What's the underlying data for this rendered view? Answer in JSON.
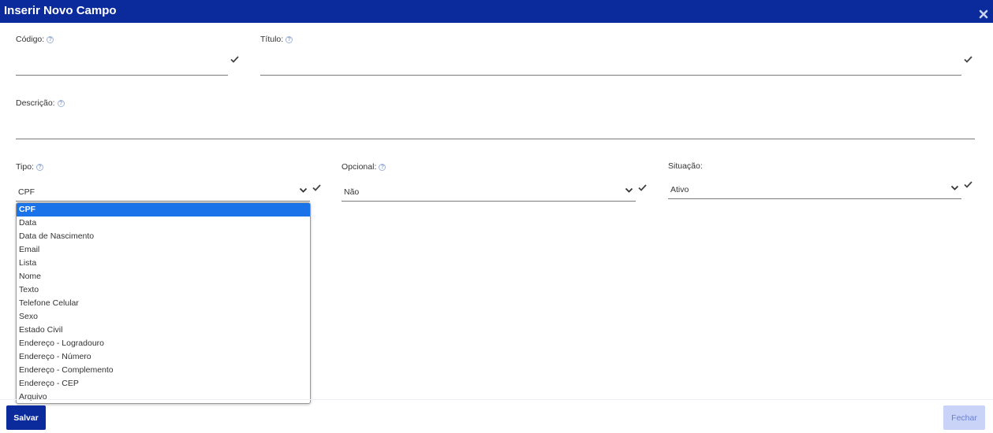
{
  "dialog": {
    "title": "Inserir Novo Campo"
  },
  "fields": {
    "codigo": {
      "label": "Código:",
      "value": ""
    },
    "titulo": {
      "label": "Título:",
      "value": ""
    },
    "descricao": {
      "label": "Descrição:",
      "value": ""
    },
    "tipo": {
      "label": "Tipo:",
      "value": "CPF"
    },
    "opcional": {
      "label": "Opcional:",
      "value": "Não"
    },
    "situacao": {
      "label": "Situação:",
      "value": "Ativo"
    }
  },
  "tipo_options": [
    "CPF",
    "Data",
    "Data de Nascimento",
    "Email",
    "Lista",
    "Nome",
    "Texto",
    "Telefone Celular",
    "Sexo",
    "Estado Civil",
    "Endereço - Logradouro",
    "Endereço - Número",
    "Endereço - Complemento",
    "Endereço - CEP",
    "Arquivo"
  ],
  "buttons": {
    "save": "Salvar",
    "close": "Fechar"
  },
  "colors": {
    "header": "#0b2a9c",
    "selected_option": "#1a73e8",
    "close_button_bg": "#c8d3f7"
  },
  "icons": {
    "help": "question-circle-icon",
    "valid": "check-icon",
    "dropdown": "chevron-down-icon",
    "close": "close-icon"
  }
}
